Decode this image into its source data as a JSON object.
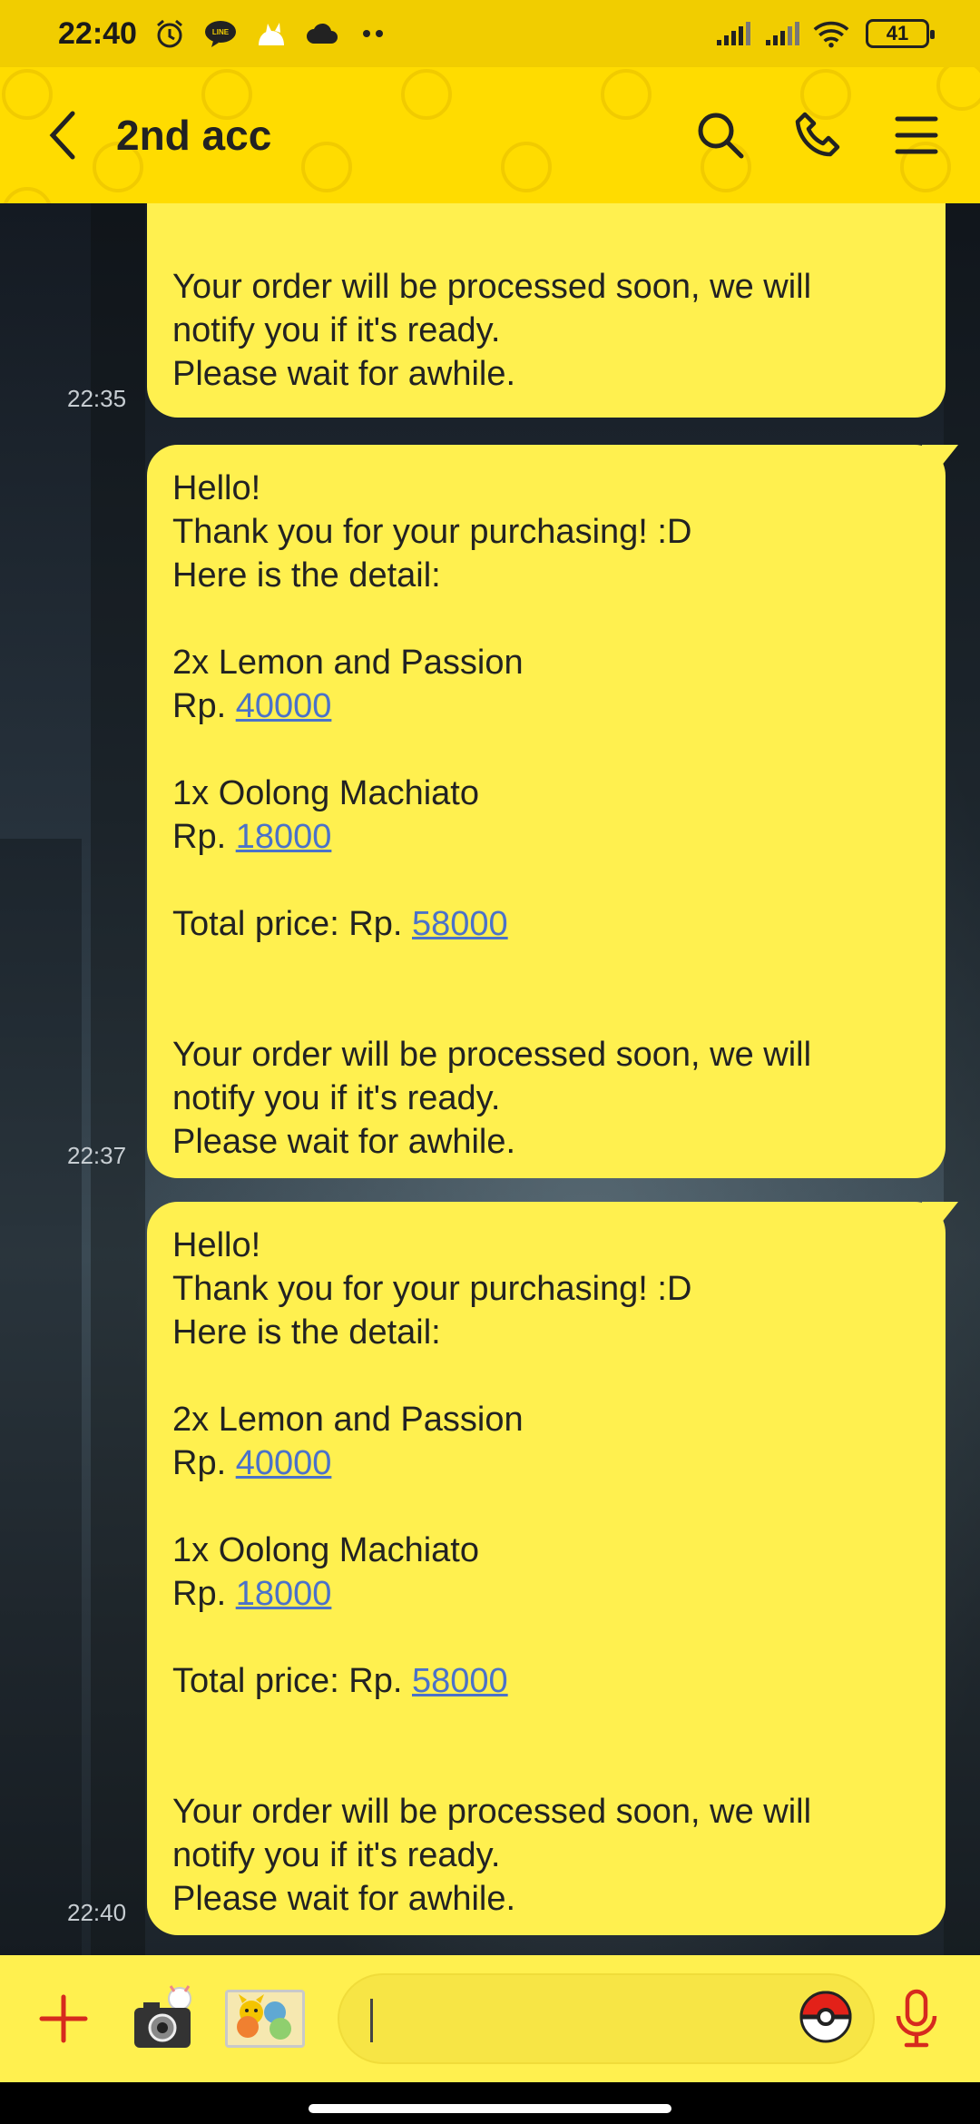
{
  "status_bar": {
    "time": "22:40",
    "battery": "41",
    "icons": [
      "alarm-icon",
      "line-app-icon",
      "pet-icon",
      "cloud-icon",
      "more-dots-icon",
      "signal-icon",
      "signal-icon",
      "wifi-icon",
      "battery-icon"
    ]
  },
  "header": {
    "title": "2nd acc",
    "icons": [
      "back-arrow-icon",
      "search-icon",
      "phone-icon",
      "menu-icon"
    ]
  },
  "messages": [
    {
      "time": "22:35",
      "lines": [
        {
          "text": "Your order will be processed soon, we will"
        },
        {
          "text": "notify you if it's ready."
        },
        {
          "text": "Please wait for awhile."
        }
      ]
    },
    {
      "time": "22:37",
      "lines": [
        {
          "text": "Hello!"
        },
        {
          "text": "Thank you for your purchasing! :D"
        },
        {
          "text": "Here is the detail:"
        },
        {
          "text": ""
        },
        {
          "text": "2x Lemon and Passion"
        },
        {
          "text": "Rp. ",
          "link": "40000"
        },
        {
          "text": ""
        },
        {
          "text": "1x Oolong Machiato"
        },
        {
          "text": "Rp. ",
          "link": "18000"
        },
        {
          "text": ""
        },
        {
          "text": "Total price: Rp. ",
          "link": "58000"
        },
        {
          "text": ""
        },
        {
          "text": ""
        },
        {
          "text": "Your order will be processed soon, we will"
        },
        {
          "text": "notify you if it's ready."
        },
        {
          "text": "Please wait for awhile."
        }
      ]
    },
    {
      "time": "22:40",
      "lines": [
        {
          "text": "Hello!"
        },
        {
          "text": "Thank you for your purchasing! :D"
        },
        {
          "text": "Here is the detail:"
        },
        {
          "text": ""
        },
        {
          "text": "2x Lemon and Passion"
        },
        {
          "text": "Rp. ",
          "link": "40000"
        },
        {
          "text": ""
        },
        {
          "text": "1x Oolong Machiato"
        },
        {
          "text": "Rp. ",
          "link": "18000"
        },
        {
          "text": ""
        },
        {
          "text": "Total price: Rp. ",
          "link": "58000"
        },
        {
          "text": ""
        },
        {
          "text": ""
        },
        {
          "text": "Your order will be processed soon, we will"
        },
        {
          "text": "notify you if it's ready."
        },
        {
          "text": "Please wait for awhile."
        }
      ]
    }
  ],
  "input_bar": {
    "input_value": "",
    "icons": [
      "plus-icon",
      "camera-icon",
      "sticker-icon",
      "pokeball-icon",
      "microphone-icon"
    ]
  },
  "colors": {
    "header": "#ffdc00",
    "status_bar": "#f1cd00",
    "bubble": "#fff04f",
    "link": "#4b72c9",
    "accent_red": "#d62a1e"
  }
}
